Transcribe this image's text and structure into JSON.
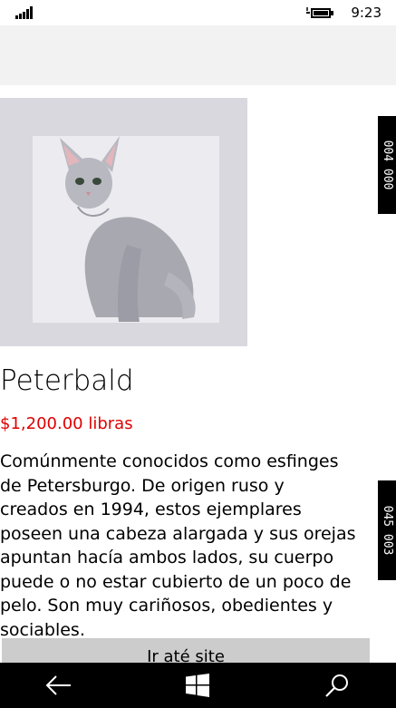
{
  "status_bar": {
    "time": "9:23",
    "signal_icon": "signal-strength-icon",
    "battery_icon": "battery-charging-icon"
  },
  "product": {
    "image_icon": "cat-photo",
    "title": "Peterbald",
    "price": "$1,200.00 libras",
    "description": "Comúnmente conocidos como esfinges de Petersburgo. De origen ruso y creados en 1994, estos ejemplares poseen una cabeza alargada y sus orejas apuntan hacía ambos lados, su cuerpo puede o no estar cubierto de un poco de pelo. Son muy cariñosos, obedientes y sociables.",
    "button_label": "Ir até site"
  },
  "side_tags": [
    "004  000",
    "045  003"
  ],
  "nav_bar": {
    "back_icon": "back-arrow-icon",
    "home_icon": "windows-logo-icon",
    "search_icon": "search-icon"
  },
  "colors": {
    "price": "#e00000",
    "nav_bar": "#000000",
    "app_bar": "#f2f2f2",
    "button": "#cccccc"
  }
}
